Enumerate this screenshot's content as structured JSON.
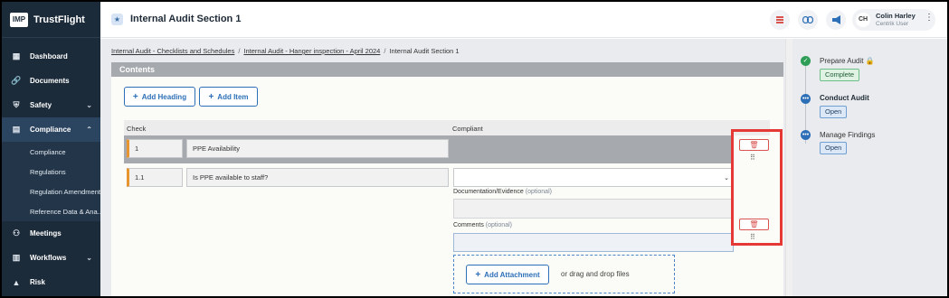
{
  "brand": {
    "logo": "IMP",
    "name": "TrustFlight"
  },
  "sidebar": {
    "items": [
      {
        "label": "Dashboard",
        "icon": "▦"
      },
      {
        "label": "Documents",
        "icon": "🔗"
      },
      {
        "label": "Safety",
        "icon": "⛨",
        "chevron": "⌄"
      },
      {
        "label": "Compliance",
        "icon": "▤",
        "chevron": "⌃"
      }
    ],
    "subitems": [
      "Compliance",
      "Regulations",
      "Regulation Amendments",
      "Reference Data & Ana..."
    ],
    "bottom_items": [
      {
        "label": "Meetings",
        "icon": "⚇"
      },
      {
        "label": "Workflows",
        "icon": "▥",
        "chevron": "⌄"
      },
      {
        "label": "Risk",
        "icon": "▲"
      }
    ]
  },
  "header": {
    "title": "Internal Audit Section 1",
    "user_initials": "CH",
    "user_name": "Colin Harley",
    "user_role": "Centrik User"
  },
  "breadcrumb": {
    "items": [
      "Internal Audit - Checklists and Schedules",
      "Internal Audit - Hanger inspection - April 2024"
    ],
    "current": "Internal Audit Section 1"
  },
  "contents": {
    "title": "Contents",
    "add_heading": "Add Heading",
    "add_item": "Add Item"
  },
  "table": {
    "col_check": "Check",
    "col_compliant": "Compliant",
    "heading_row": {
      "number": "1",
      "text": "PPE Availability"
    },
    "item_row": {
      "number": "1.1",
      "question": "Is PPE available to staff?",
      "documentation_label": "Documentation/Evidence",
      "comments_label": "Comments",
      "optional": "(optional)",
      "add_attachment": "Add Attachment",
      "drop_text": "or drag and drop files"
    }
  },
  "steps": [
    {
      "title": "Prepare Audit",
      "status": "Complete",
      "state": "done"
    },
    {
      "title": "Conduct Audit",
      "status": "Open",
      "state": "current"
    },
    {
      "title": "Manage Findings",
      "status": "Open",
      "state": "pending"
    }
  ],
  "colors": {
    "accent": "#2d6fb7",
    "sidebar": "#1c2b3a",
    "danger": "#d9534f",
    "highlight": "#e53935"
  }
}
